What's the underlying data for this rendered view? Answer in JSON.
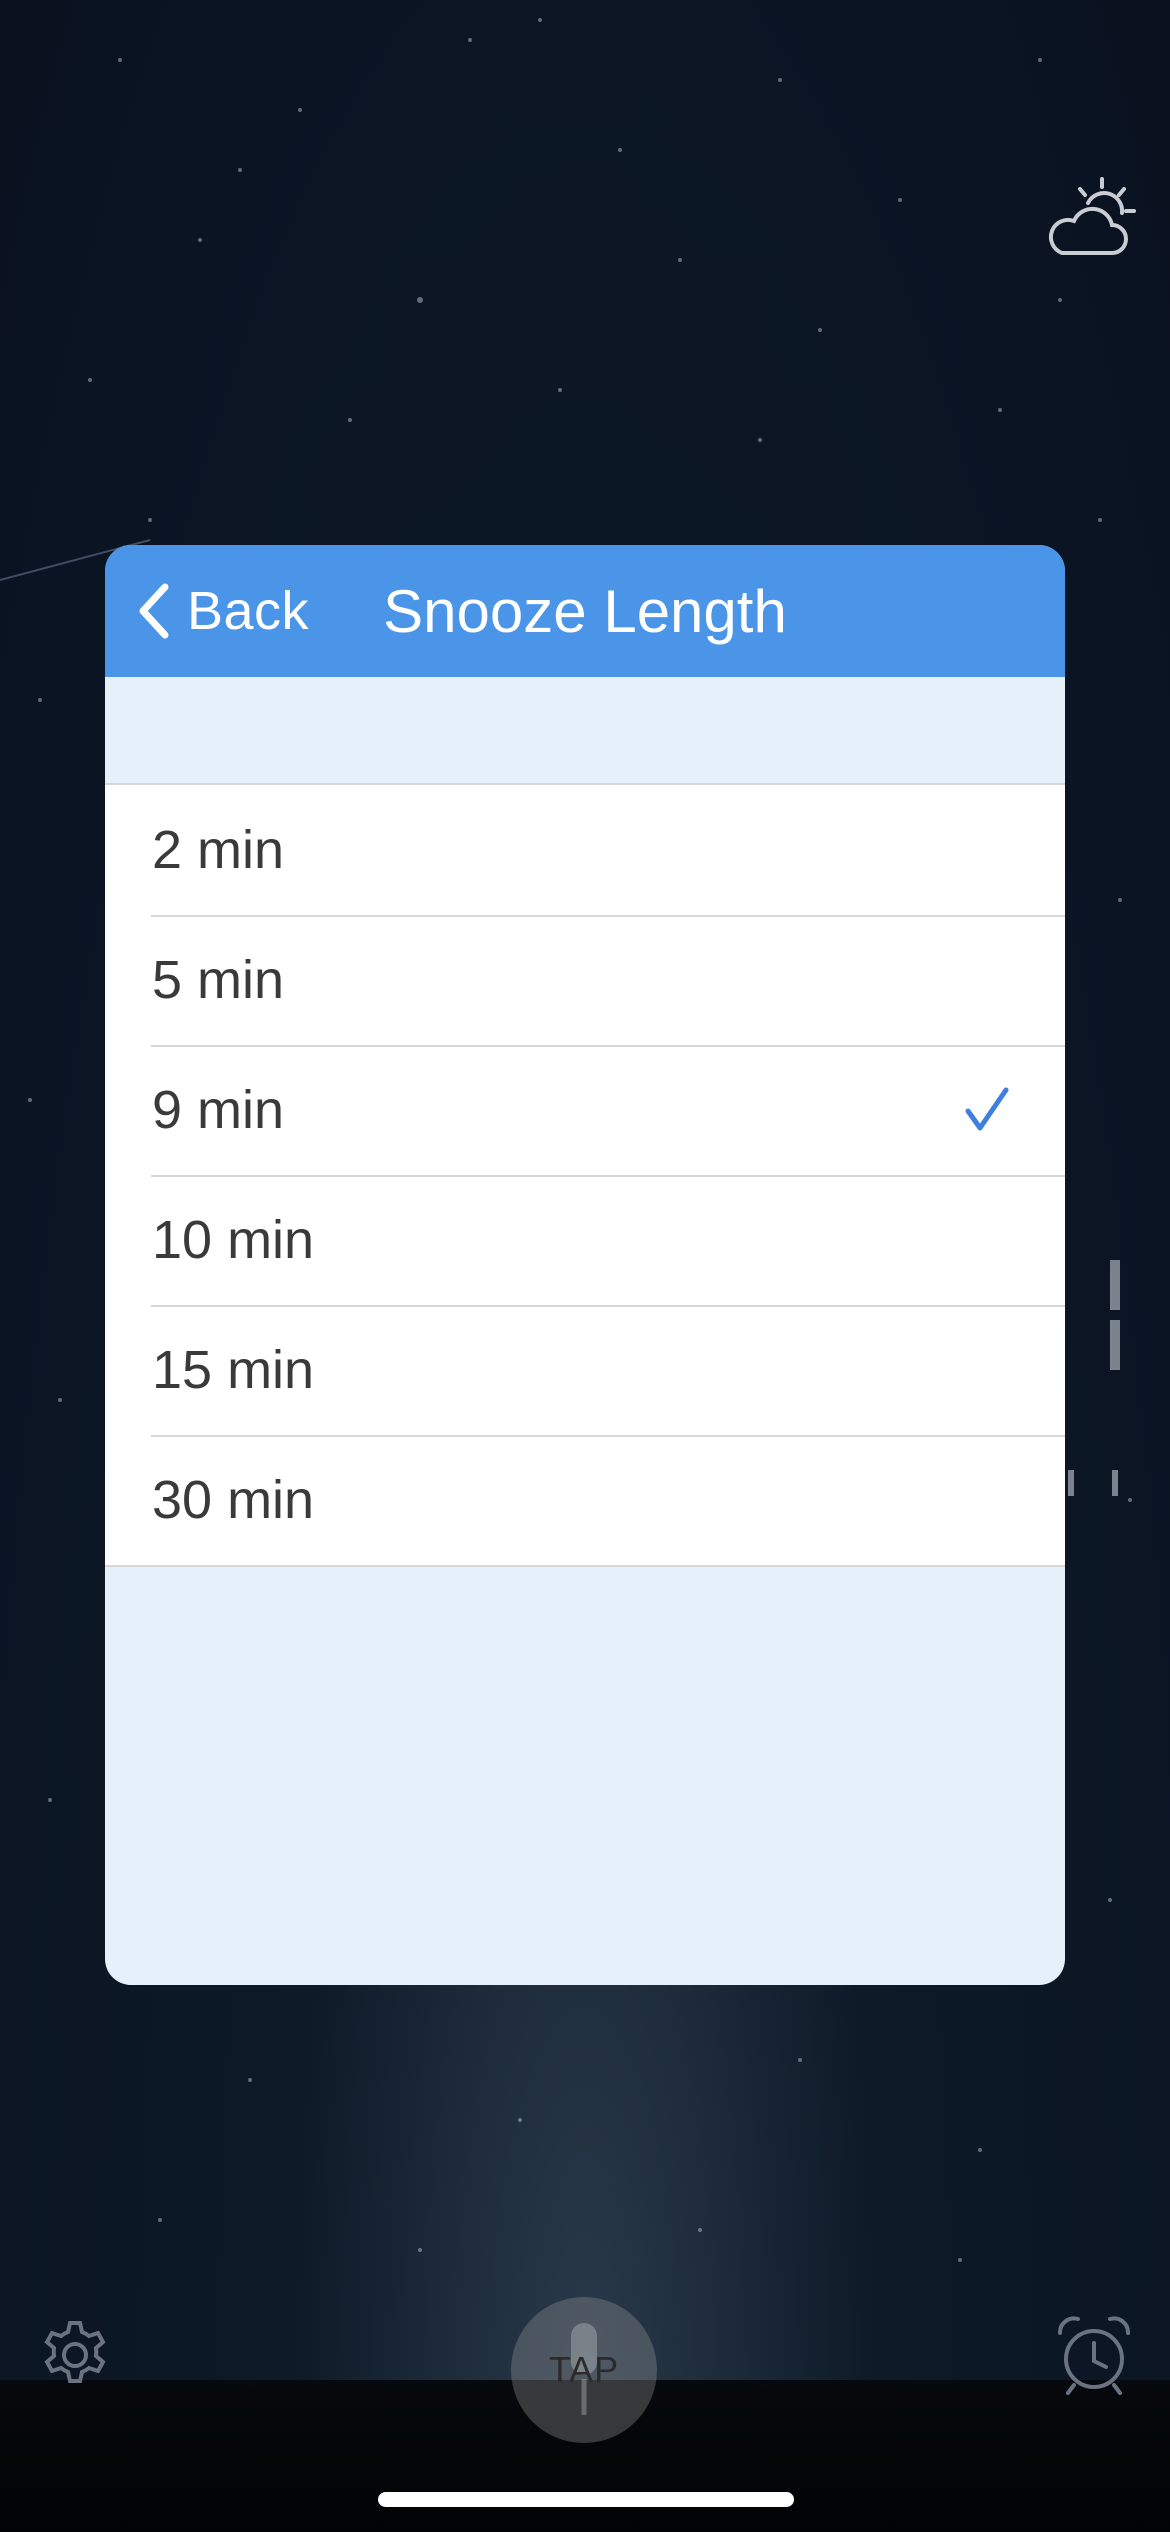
{
  "header": {
    "back_label": "Back",
    "title": "Snooze Length"
  },
  "options": [
    {
      "label": "2 min",
      "selected": false
    },
    {
      "label": "5 min",
      "selected": false
    },
    {
      "label": "9 min",
      "selected": true
    },
    {
      "label": "10 min",
      "selected": false
    },
    {
      "label": "15 min",
      "selected": false
    },
    {
      "label": "30 min",
      "selected": false
    }
  ],
  "bottom_bar": {
    "tap_label": "TAP",
    "left_icon": "gear-icon",
    "right_icon": "alarm-clock-icon"
  },
  "status": {
    "weather_icon": "partly-cloudy-icon"
  },
  "colors": {
    "accent": "#4a95e8",
    "check": "#3f7fe0",
    "modal_background": "#e5f0fb"
  }
}
